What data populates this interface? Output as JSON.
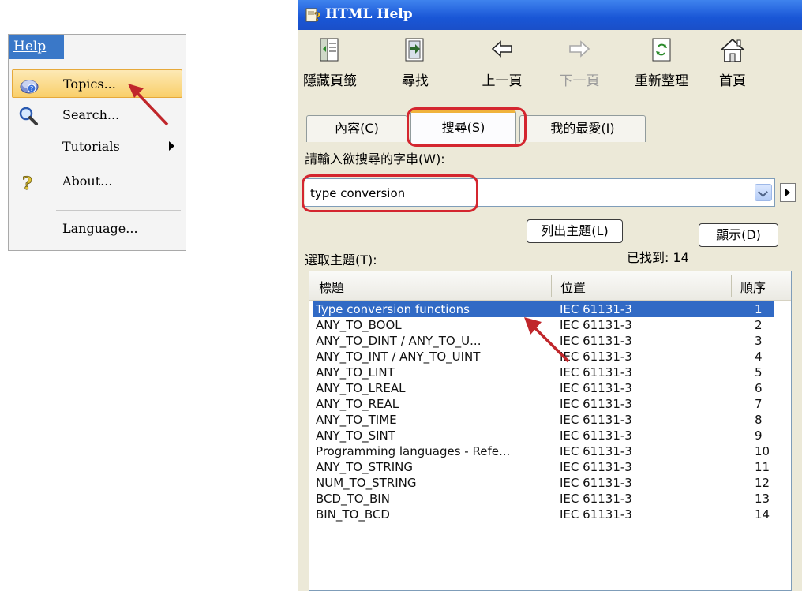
{
  "help_menu": {
    "title": "Help",
    "items": [
      {
        "label": "Topics...",
        "selected": true,
        "icon": "help-book-icon"
      },
      {
        "label": "Search...",
        "icon": "magnifier-icon"
      },
      {
        "label": "Tutorials",
        "has_submenu": true
      },
      {
        "label": "About...",
        "icon": "question-mark-icon"
      },
      {
        "label": "Language..."
      }
    ]
  },
  "window": {
    "title": "HTML Help",
    "toolbar": [
      {
        "label": "隱藏頁籤",
        "icon": "hide-tabs-icon"
      },
      {
        "label": "尋找",
        "icon": "locate-icon"
      },
      {
        "label": "上一頁",
        "icon": "back-arrow-icon"
      },
      {
        "label": "下一頁",
        "icon": "forward-arrow-icon",
        "disabled": true
      },
      {
        "label": "重新整理",
        "icon": "refresh-icon"
      },
      {
        "label": "首頁",
        "icon": "home-icon"
      }
    ],
    "tabs": [
      {
        "label": "內容(C)"
      },
      {
        "label": "搜尋(S)",
        "active": true
      },
      {
        "label": "我的最愛(I)"
      }
    ],
    "search": {
      "prompt": "請輸入欲搜尋的字串(W):",
      "value": "type conversion"
    },
    "buttons": {
      "list_topics": "列出主題(L)",
      "display": "顯示(D)"
    },
    "select_topic_label": "選取主題(T):",
    "found_label": "已找到: 14",
    "results": {
      "columns": [
        "標題",
        "位置",
        "順序"
      ],
      "rows": [
        {
          "title": "Type conversion functions",
          "location": "IEC 61131-3",
          "order": "1",
          "selected": true
        },
        {
          "title": "ANY_TO_BOOL",
          "location": "IEC 61131-3",
          "order": "2"
        },
        {
          "title": "ANY_TO_DINT / ANY_TO_U...",
          "location": "IEC 61131-3",
          "order": "3"
        },
        {
          "title": "ANY_TO_INT / ANY_TO_UINT",
          "location": "IEC 61131-3",
          "order": "4"
        },
        {
          "title": "ANY_TO_LINT",
          "location": "IEC 61131-3",
          "order": "5"
        },
        {
          "title": "ANY_TO_LREAL",
          "location": "IEC 61131-3",
          "order": "6"
        },
        {
          "title": "ANY_TO_REAL",
          "location": "IEC 61131-3",
          "order": "7"
        },
        {
          "title": "ANY_TO_TIME",
          "location": "IEC 61131-3",
          "order": "8"
        },
        {
          "title": "ANY_TO_SINT",
          "location": "IEC 61131-3",
          "order": "9"
        },
        {
          "title": "Programming languages - Refe...",
          "location": "IEC 61131-3",
          "order": "10"
        },
        {
          "title": "ANY_TO_STRING",
          "location": "IEC 61131-3",
          "order": "11"
        },
        {
          "title": "NUM_TO_STRING",
          "location": "IEC 61131-3",
          "order": "12"
        },
        {
          "title": "BCD_TO_BIN",
          "location": "IEC 61131-3",
          "order": "13"
        },
        {
          "title": "BIN_TO_BCD",
          "location": "IEC 61131-3",
          "order": "14"
        }
      ]
    }
  },
  "colors": {
    "selection": "#316ac5",
    "highlight_box": "#d4262f",
    "titlebar": "#1956d6"
  }
}
